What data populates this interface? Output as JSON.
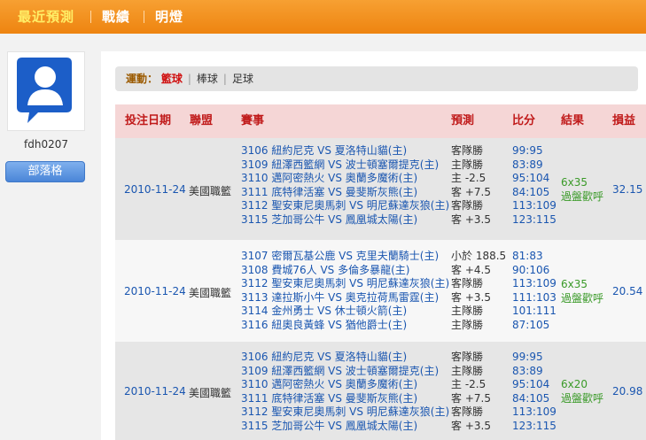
{
  "nav": {
    "tabs": [
      "最近預測",
      "戰績",
      "明燈"
    ],
    "active_index": 0
  },
  "user": {
    "name": "fdh0207",
    "blog_button": "部落格"
  },
  "sport_filter": {
    "label": "運動：",
    "options": [
      "籃球",
      "棒球",
      "足球"
    ],
    "selected": "籃球"
  },
  "table": {
    "headers": [
      "投注日期",
      "聯盟",
      "賽事",
      "預測",
      "比分",
      "結果",
      "損益"
    ],
    "rows": [
      {
        "date": "2010-11-24",
        "league": "美國職籃",
        "games": [
          "3106 紐約尼克 VS 夏洛特山貓(主)",
          "3109 紐澤西籃網 VS 波士頓塞爾提克(主)",
          "3110 邁阿密熱火 VS 奧蘭多魔術(主)",
          "3111 底特律活塞 VS 曼斐斯灰熊(主)",
          "3112 聖安東尼奧馬刺 VS 明尼蘇達灰狼(主)",
          "3115 芝加哥公牛 VS 鳳凰城太陽(主)"
        ],
        "predictions": [
          "客隊勝",
          "主隊勝",
          "主 -2.5",
          "客 +7.5",
          "客隊勝",
          "客 +3.5"
        ],
        "scores": [
          "99:95",
          "83:89",
          "95:104",
          "84:105",
          "113:109",
          "123:115"
        ],
        "result": [
          "6x35",
          "過盤歡呼"
        ],
        "profit": "32.15"
      },
      {
        "date": "2010-11-24",
        "league": "美國職籃",
        "games": [
          "3107 密爾瓦基公鹿 VS 克里夫蘭騎士(主)",
          "3108 費城76人 VS 多倫多暴龍(主)",
          "3112 聖安東尼奧馬刺 VS 明尼蘇達灰狼(主)",
          "3113 達拉斯小牛 VS 奧克拉荷馬雷霆(主)",
          "3114 金州勇士 VS 休士頓火箭(主)",
          "3116 紐奧良黃蜂 VS 猶他爵士(主)"
        ],
        "predictions": [
          "小於 188.5",
          "客 +4.5",
          "客隊勝",
          "客 +3.5",
          "主隊勝",
          "主隊勝"
        ],
        "scores": [
          "81:83",
          "90:106",
          "113:109",
          "111:103",
          "101:111",
          "87:105"
        ],
        "result": [
          "6x35",
          "過盤歡呼"
        ],
        "profit": "20.54"
      },
      {
        "date": "2010-11-24",
        "league": "美國職籃",
        "games": [
          "3106 紐約尼克 VS 夏洛特山貓(主)",
          "3109 紐澤西籃網 VS 波士頓塞爾提克(主)",
          "3110 邁阿密熱火 VS 奧蘭多魔術(主)",
          "3111 底特律活塞 VS 曼斐斯灰熊(主)",
          "3112 聖安東尼奧馬刺 VS 明尼蘇達灰狼(主)",
          "3115 芝加哥公牛 VS 鳳凰城太陽(主)"
        ],
        "predictions": [
          "客隊勝",
          "主隊勝",
          "主 -2.5",
          "客 +7.5",
          "客隊勝",
          "客 +3.5"
        ],
        "scores": [
          "99:95",
          "83:89",
          "95:104",
          "84:105",
          "113:109",
          "123:115"
        ],
        "result": [
          "6x20",
          "過盤歡呼"
        ],
        "profit": "20.98"
      }
    ]
  }
}
